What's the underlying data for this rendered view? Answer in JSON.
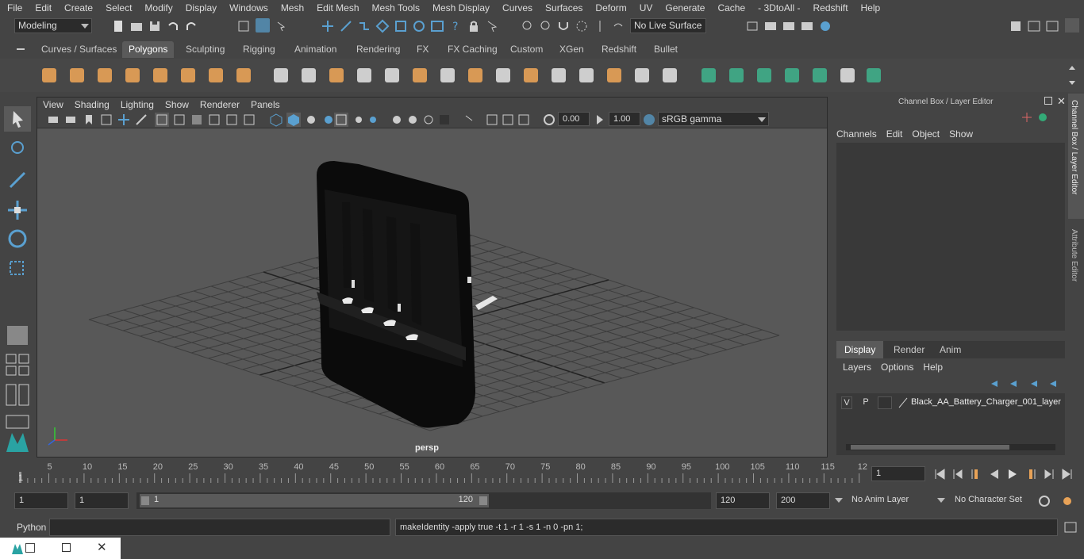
{
  "menu": [
    "File",
    "Edit",
    "Create",
    "Select",
    "Modify",
    "Display",
    "Windows",
    "Mesh",
    "Edit Mesh",
    "Mesh Tools",
    "Mesh Display",
    "Curves",
    "Surfaces",
    "Deform",
    "UV",
    "Generate",
    "Cache",
    "- 3DtoAll -",
    "Redshift",
    "Help"
  ],
  "status": {
    "mode": "Modeling",
    "live_surface": "No Live Surface"
  },
  "shelf_tabs": [
    "Curves / Surfaces",
    "Polygons",
    "Sculpting",
    "Rigging",
    "Animation",
    "Rendering",
    "FX",
    "FX Caching",
    "Custom",
    "XGen",
    "Redshift",
    "Bullet"
  ],
  "shelf_active": "Polygons",
  "viewport": {
    "menu": [
      "View",
      "Shading",
      "Lighting",
      "Show",
      "Renderer",
      "Panels"
    ],
    "exposure": "0.00",
    "gamma": "1.00",
    "color_space": "sRGB gamma",
    "camera_label": "persp"
  },
  "channel_box": {
    "title": "Channel Box / Layer Editor",
    "menu": [
      "Channels",
      "Edit",
      "Object",
      "Show"
    ],
    "layer_tabs": [
      "Display",
      "Render",
      "Anim"
    ],
    "layer_active": "Display",
    "layer_menu": [
      "Layers",
      "Options",
      "Help"
    ],
    "layer_v": "V",
    "layer_p": "P",
    "layer_name": "Black_AA_Battery_Charger_001_layer"
  },
  "side_tabs": [
    "Channel Box / Layer Editor",
    "Attribute Editor"
  ],
  "timeline": {
    "ticks": [
      "5",
      "10",
      "15",
      "20",
      "25",
      "30",
      "35",
      "40",
      "45",
      "50",
      "55",
      "60",
      "65",
      "70",
      "75",
      "80",
      "85",
      "90",
      "95",
      "100",
      "105",
      "110",
      "115",
      "12"
    ],
    "start_marker": "1",
    "current_frame": "1"
  },
  "range": {
    "start": "1",
    "inner_start": "1",
    "slider_start": "1",
    "slider_end": "120",
    "end": "120",
    "outer_end": "200",
    "anim_layer": "No Anim Layer",
    "char_set": "No Character Set"
  },
  "cmd": {
    "lang": "Python",
    "output": "makeIdentity -apply true -t 1 -r 1 -s 1 -n 0 -pn 1;"
  },
  "colors": {
    "accent": "#5285a6",
    "shelf_orange": "#e8a257",
    "shelf_green": "#3fae8a"
  }
}
